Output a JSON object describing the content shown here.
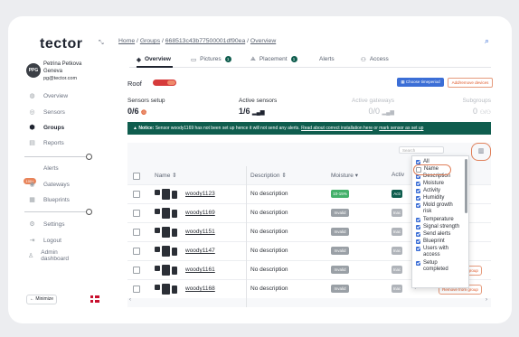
{
  "brand": {
    "logo_text": "tector"
  },
  "user": {
    "initials": "PPG",
    "name": "Petrina Petkova Geneva",
    "email": "pg@tector.com"
  },
  "nav": {
    "items": [
      {
        "label": "Overview",
        "icon": "globe-icon"
      },
      {
        "label": "Sensors",
        "icon": "sensor-icon"
      },
      {
        "label": "Groups",
        "icon": "groups-icon",
        "active": true
      },
      {
        "label": "Reports",
        "icon": "report-icon"
      },
      {
        "label": "Alerts",
        "icon": "bell-icon",
        "badge": "100+"
      },
      {
        "label": "Gateways",
        "icon": "gateway-icon"
      },
      {
        "label": "Blueprints",
        "icon": "blueprint-icon"
      },
      {
        "label": "Settings",
        "icon": "gear-icon"
      },
      {
        "label": "Logout",
        "icon": "logout-icon"
      },
      {
        "label": "Admin dashboard",
        "icon": "admin-icon"
      }
    ],
    "minimize_label": "Minimize"
  },
  "breadcrumb": {
    "home": "Home",
    "groups": "Groups",
    "id": "668513c43b77500001df90ea",
    "current": "Overview"
  },
  "tabs": [
    {
      "label": "Overview",
      "active": true
    },
    {
      "label": "Pictures",
      "count": "1"
    },
    {
      "label": "Placement",
      "count": "1"
    },
    {
      "label": "Alerts"
    },
    {
      "label": "Access"
    }
  ],
  "group": {
    "name": "Roof",
    "choose_period_label": "Choose timeperiod",
    "add_remove_label": "Add/remove devices"
  },
  "stats": {
    "sensors_setup": {
      "label": "Sensors setup",
      "value": "0/6"
    },
    "active_sensors": {
      "label": "Active sensors",
      "value": "1/6"
    },
    "active_gateways": {
      "label": "Active gateways",
      "value": "0/0"
    },
    "subgroups": {
      "label": "Subgroups",
      "value": "0"
    }
  },
  "notice": {
    "prefix": "Notice:",
    "text": "Sensor woody1169 has not been set up hence it will not send any alerts.",
    "link1": "Read about correct installation here",
    "middle": "or",
    "link2": "mark sensor as set up"
  },
  "table": {
    "search_placeholder": "Search",
    "headers": {
      "name": "Name",
      "description": "Description",
      "moisture": "Moisture",
      "activity": "Activ"
    },
    "rows": [
      {
        "name": "woody1123",
        "description": "No description",
        "moisture": "10-15%",
        "activity": "Acti"
      },
      {
        "name": "woody1169",
        "description": "No description",
        "moisture": "Invalid",
        "activity": "Inac"
      },
      {
        "name": "woody1151",
        "description": "No description",
        "moisture": "Invalid",
        "activity": "Inac"
      },
      {
        "name": "woody1147",
        "description": "No description",
        "moisture": "Invalid",
        "activity": "Inac"
      },
      {
        "name": "woody1161",
        "description": "No description",
        "moisture": "Invalid",
        "activity": "Inac"
      },
      {
        "name": "woody1168",
        "description": "No description",
        "moisture": "Invalid",
        "activity": "Inac"
      }
    ],
    "remove_label": "Remove from group"
  },
  "column_menu": {
    "options": [
      {
        "label": "All",
        "checked": true
      },
      {
        "label": "Name",
        "checked": false
      },
      {
        "label": "Description",
        "checked": true
      },
      {
        "label": "Moisture",
        "checked": true
      },
      {
        "label": "Activity",
        "checked": true
      },
      {
        "label": "Humidity",
        "checked": true
      },
      {
        "label": "Mold growth risk",
        "checked": true
      },
      {
        "label": "Temperature",
        "checked": true
      },
      {
        "label": "Signal strength",
        "checked": true
      },
      {
        "label": "Send alerts",
        "checked": true
      },
      {
        "label": "Blueprint",
        "checked": true
      },
      {
        "label": "Users with access",
        "checked": true
      },
      {
        "label": "Setup completed",
        "checked": true
      }
    ]
  },
  "colors": {
    "brand_green": "#0f5d4e",
    "accent_orange": "#e05a2b",
    "primary_blue": "#3b6ed6"
  }
}
